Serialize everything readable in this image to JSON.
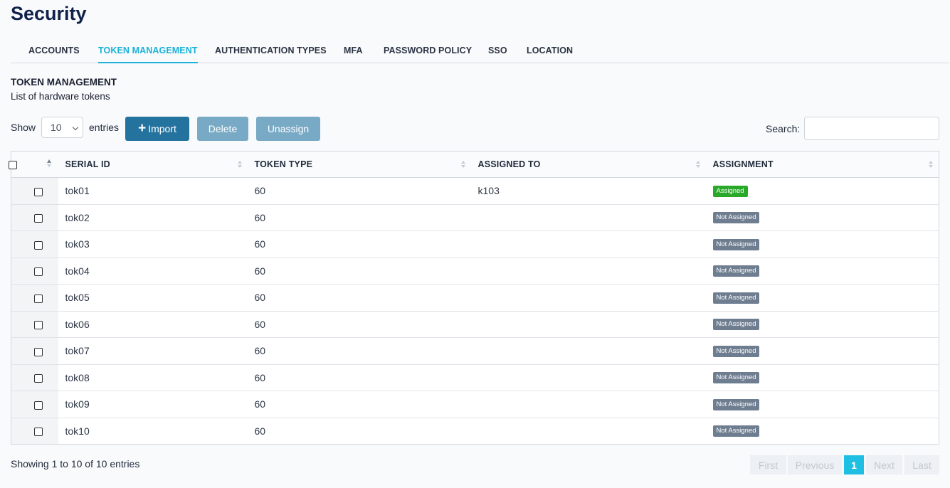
{
  "page_title": "Security",
  "tabs": [
    {
      "label": "ACCOUNTS"
    },
    {
      "label": "TOKEN MANAGEMENT",
      "active": true
    },
    {
      "label": "AUTHENTICATION TYPES"
    },
    {
      "label": "MFA"
    },
    {
      "label": "PASSWORD POLICY"
    },
    {
      "label": "SSO"
    },
    {
      "label": "LOCATION"
    }
  ],
  "section": {
    "title": "TOKEN MANAGEMENT",
    "subtitle": "List of hardware tokens"
  },
  "toolbar": {
    "show_label": "Show",
    "entries_value": "10",
    "entries_label": "entries",
    "import_label": "Import",
    "delete_label": "Delete",
    "unassign_label": "Unassign",
    "search_label": "Search:",
    "search_value": ""
  },
  "table": {
    "columns": [
      "SERIAL ID",
      "TOKEN TYPE",
      "ASSIGNED TO",
      "ASSIGNMENT"
    ],
    "rows": [
      {
        "serial": "tok01",
        "type": "60",
        "assigned_to": "k103",
        "assignment": "Assigned"
      },
      {
        "serial": "tok02",
        "type": "60",
        "assigned_to": "",
        "assignment": "Not Assigned"
      },
      {
        "serial": "tok03",
        "type": "60",
        "assigned_to": "",
        "assignment": "Not Assigned"
      },
      {
        "serial": "tok04",
        "type": "60",
        "assigned_to": "",
        "assignment": "Not Assigned"
      },
      {
        "serial": "tok05",
        "type": "60",
        "assigned_to": "",
        "assignment": "Not Assigned"
      },
      {
        "serial": "tok06",
        "type": "60",
        "assigned_to": "",
        "assignment": "Not Assigned"
      },
      {
        "serial": "tok07",
        "type": "60",
        "assigned_to": "",
        "assignment": "Not Assigned"
      },
      {
        "serial": "tok08",
        "type": "60",
        "assigned_to": "",
        "assignment": "Not Assigned"
      },
      {
        "serial": "tok09",
        "type": "60",
        "assigned_to": "",
        "assignment": "Not Assigned"
      },
      {
        "serial": "tok10",
        "type": "60",
        "assigned_to": "",
        "assignment": "Not Assigned"
      }
    ]
  },
  "footer": {
    "info": "Showing 1 to 10 of 10 entries",
    "pager": {
      "first": "First",
      "previous": "Previous",
      "current": "1",
      "next": "Next",
      "last": "Last"
    }
  },
  "colors": {
    "accent": "#1ab2d8",
    "primary_button": "#24739f",
    "disabled_button": "#78a9c5",
    "assigned_badge": "#2aa82a",
    "not_assigned_badge": "#6f7d90"
  }
}
